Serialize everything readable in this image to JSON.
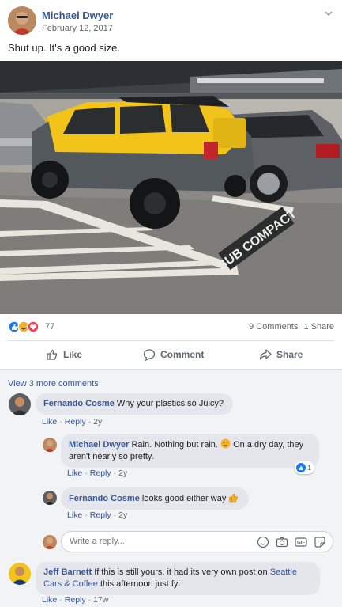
{
  "post": {
    "author": "Michael Dwyer",
    "date": "February 12, 2017",
    "text": "Shut up. It's a good size.",
    "stall_marking": "SUB COMPACT",
    "reactions_count": "77",
    "comments_count": "9 Comments",
    "shares_count": "1 Share"
  },
  "actions": {
    "like": "Like",
    "comment": "Comment",
    "share": "Share"
  },
  "comments": {
    "view_more": "View 3 more comments",
    "items": [
      {
        "name": "Fernando Cosme",
        "text": "Why your plastics so Juicy?",
        "like": "Like",
        "reply": "Reply",
        "time": "2y"
      },
      {
        "name": "Michael Dwyer",
        "text_a": "Rain. Nothing but rain.",
        "text_b": "On a dry day, they aren't nearly so pretty.",
        "like": "Like",
        "reply": "Reply",
        "time": "2y",
        "reactions": "1"
      },
      {
        "name": "Fernando Cosme",
        "text": "looks good either way",
        "like": "Like",
        "reply": "Reply",
        "time": "2y"
      },
      {
        "name": "Jeff Barnett",
        "text_a": "If this is still yours, it had its very own post on",
        "link": "Seattle Cars & Coffee",
        "text_b": "this afternoon just fyi",
        "like": "Like",
        "reply": "Reply",
        "time": "17w"
      }
    ]
  },
  "reply_box": {
    "placeholder": "Write a reply..."
  },
  "colors": {
    "link": "#385898",
    "meta": "#606770",
    "bubble": "#e4e6eb",
    "car_yellow": "#f2c318"
  }
}
